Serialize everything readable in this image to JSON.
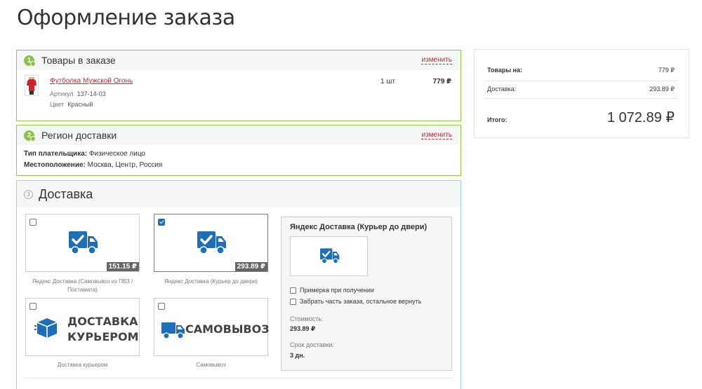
{
  "page": {
    "title": "Оформление заказа"
  },
  "cart": {
    "step": "1",
    "title": "Товары в заказе",
    "edit_label": "изменить",
    "item": {
      "name": "Футболка Мужской Огонь",
      "article_label": "Артикул",
      "article": "137-14-03",
      "color_label": "Цвет",
      "color": "Красный",
      "qty": "1 шт",
      "price": "779 ₽"
    }
  },
  "region": {
    "step": "2",
    "title": "Регион доставки",
    "edit_label": "изменить",
    "payer_label": "Тип плательщика:",
    "payer": "Физическое лицо",
    "location_label": "Местоположение:",
    "location": "Москва, Центр, Россия"
  },
  "delivery": {
    "step": "3",
    "title": "Доставка",
    "options": [
      {
        "price": "151.15 ₽",
        "caption_1": "Яндекс Доставка (Самовывоз из ПВЗ /",
        "caption_2": "Постамата)",
        "checked": false
      },
      {
        "price": "293.89 ₽",
        "caption_1": "Яндекс Доставка (Курьер до двери)",
        "caption_2": "",
        "checked": true
      },
      {
        "label_1": "ДОСТАВКА",
        "label_2": "КУРЬЕРОМ",
        "caption_1": "Доставка курьером",
        "checked": false
      },
      {
        "label_1": "САМОВЫВОЗ",
        "caption_1": "Самовывоз",
        "checked": false
      }
    ],
    "detail": {
      "title": "Яндекс Доставка (Курьер до двери)",
      "option_1": "Примерка при получении",
      "option_2": "Забрать часть заказа, остальное вернуть",
      "cost_label": "Стоимость:",
      "cost": "293.89 ₽",
      "term_label": "Срок доставки:",
      "term": "3 дн."
    }
  },
  "summary": {
    "goods_label": "Товары на:",
    "goods": "779 ₽",
    "delivery_label": "Доставка:",
    "delivery": "293.89 ₽",
    "total_label": "Итого:",
    "total": "1 072.89 ₽"
  },
  "colors": {
    "green": "#91cb3e",
    "blue_border": "#9cd0e6",
    "link_red": "#c2282f",
    "icon_blue": "#1e6fb5"
  }
}
